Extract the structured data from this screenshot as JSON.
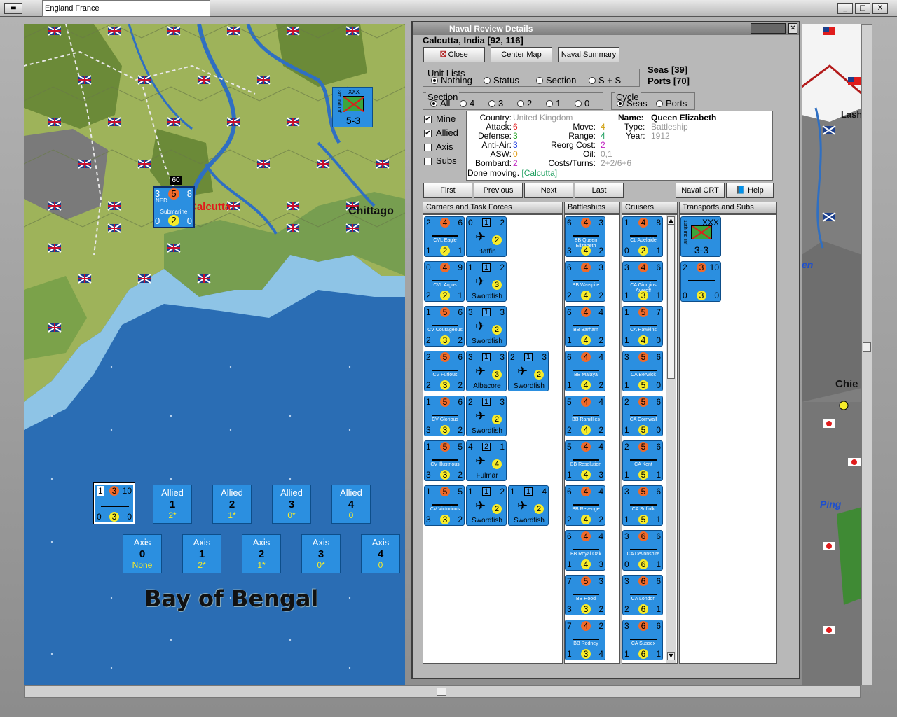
{
  "window": {
    "title": "England France",
    "buttons": [
      "_",
      "□",
      "X"
    ]
  },
  "map": {
    "labels": {
      "bay": "Bay of Bengal",
      "city": "Calcutta",
      "chittagong": "Chittago",
      "lashio": "Lashio",
      "chie": "Chie",
      "ping": "Ping",
      "en": "en"
    },
    "hex_unit": {
      "top_left": "3",
      "attack": "5",
      "top_right": "8",
      "nation": "NED",
      "name": "Submarine",
      "bottom_left": "0",
      "defense": "2",
      "bottom_right": "0",
      "badge": "60"
    },
    "corps": {
      "type": "XXX",
      "name": "3rd Ind Inf",
      "strength": "5-3"
    },
    "stack_unit": {
      "top_left": "1",
      "attack": "3",
      "top_right": "10",
      "bottom_left": "0",
      "defense": "3",
      "bottom_right": "0"
    },
    "allied_boxes": [
      {
        "side": "Allied",
        "num": "1",
        "val": "2*"
      },
      {
        "side": "Allied",
        "num": "2",
        "val": "1*"
      },
      {
        "side": "Allied",
        "num": "3",
        "val": "0*"
      },
      {
        "side": "Allied",
        "num": "4",
        "val": "0"
      }
    ],
    "axis_boxes": [
      {
        "side": "Axis",
        "num": "0",
        "val": "None"
      },
      {
        "side": "Axis",
        "num": "1",
        "val": "2*"
      },
      {
        "side": "Axis",
        "num": "2",
        "val": "1*"
      },
      {
        "side": "Axis",
        "num": "3",
        "val": "0*"
      },
      {
        "side": "Axis",
        "num": "4",
        "val": "0"
      }
    ]
  },
  "panel": {
    "title": "Naval Review Details",
    "location": "Calcutta, India [92, 116]",
    "buttons": {
      "close": "Close",
      "center_map": "Center Map",
      "naval_summary": "Naval Summary",
      "first": "First",
      "previous": "Previous",
      "next": "Next",
      "last": "Last",
      "naval_crt": "Naval CRT",
      "help": "Help"
    },
    "seas": "Seas [39]",
    "ports": "Ports [70]",
    "unit_lists": {
      "title": "Unit Lists",
      "options": [
        "Nothing",
        "Status",
        "Section",
        "S + S"
      ],
      "selected": "Nothing"
    },
    "section": {
      "title": "Section",
      "options": [
        "All",
        "4",
        "3",
        "2",
        "1",
        "0"
      ],
      "selected": "All"
    },
    "cycle": {
      "title": "Cycle",
      "options": [
        "Seas",
        "Ports"
      ],
      "selected": "Seas"
    },
    "filters": [
      {
        "label": "Mine",
        "checked": true
      },
      {
        "label": "Allied",
        "checked": true
      },
      {
        "label": "Axis",
        "checked": false
      },
      {
        "label": "Subs",
        "checked": false
      }
    ],
    "info": {
      "country_k": "Country:",
      "country_v": "United Kingdom",
      "attack_k": "Attack:",
      "attack_v": "6",
      "defense_k": "Defense:",
      "defense_v": "3",
      "antiair_k": "Anti-Air:",
      "antiair_v": "3",
      "asw_k": "ASW:",
      "asw_v": "0",
      "bombard_k": "Bombard:",
      "bombard_v": "2",
      "move_k": "Move:",
      "move_v": "4",
      "range_k": "Range:",
      "range_v": "4",
      "reorg_k": "Reorg Cost:",
      "reorg_v": "2",
      "oil_k": "Oil:",
      "oil_v": "0,1",
      "costs_k": "Costs/Turns:",
      "costs_v": "2+2/6+6",
      "name_k": "Name:",
      "name_v": "Queen Elizabeth",
      "type_k": "Type:",
      "type_v": "Battleship",
      "year_k": "Year:",
      "year_v": "1912",
      "done_k": "Done moving.",
      "done_v": "[Calcutta]"
    },
    "columns": {
      "carriers": "Carriers and Task Forces",
      "battleships": "Battleships",
      "cruisers": "Cruisers",
      "transports": "Transports and Subs"
    },
    "carriers": [
      {
        "tl": "2",
        "a": "4",
        "tr": "6",
        "name": "CVL Eagle",
        "bl": "1",
        "d": "2",
        "br": "1"
      },
      {
        "tl": "0",
        "a": "4",
        "tr": "9",
        "name": "CVL Argus",
        "bl": "2",
        "d": "2",
        "br": "1"
      },
      {
        "tl": "1",
        "a": "5",
        "tr": "6",
        "name": "CV Courageous",
        "bl": "2",
        "d": "3",
        "br": "2"
      },
      {
        "tl": "2",
        "a": "5",
        "tr": "6",
        "name": "CV Furious",
        "bl": "2",
        "d": "3",
        "br": "2"
      },
      {
        "tl": "1",
        "a": "5",
        "tr": "6",
        "name": "CV Glorious",
        "bl": "3",
        "d": "3",
        "br": "2"
      },
      {
        "tl": "1",
        "a": "5",
        "tr": "5",
        "name": "CV Illustrious",
        "bl": "3",
        "d": "3",
        "br": "2"
      },
      {
        "tl": "1",
        "a": "5",
        "tr": "5",
        "name": "CV Victorious",
        "bl": "3",
        "d": "3",
        "br": "2"
      }
    ],
    "aircraft": [
      [
        {
          "tl": "0",
          "sq": "1",
          "tr": "2",
          "c": "2",
          "name": "Baffin"
        }
      ],
      [
        {
          "tl": "1",
          "sq": "1",
          "tr": "2",
          "c": "3",
          "name": "Swordfish"
        }
      ],
      [
        {
          "tl": "3",
          "sq": "1",
          "tr": "3",
          "c": "2",
          "name": "Swordfish"
        }
      ],
      [
        {
          "tl": "3",
          "sq": "1",
          "tr": "3",
          "c": "3",
          "name": "Albacore"
        },
        {
          "tl": "2",
          "sq": "1",
          "tr": "3",
          "c": "2",
          "name": "Swordfish"
        }
      ],
      [
        {
          "tl": "2",
          "sq": "1",
          "tr": "3",
          "c": "2",
          "name": "Swordfish"
        }
      ],
      [
        {
          "tl": "4",
          "sq": "2",
          "tr": "1",
          "c": "4",
          "name": "Fulmar"
        }
      ],
      [
        {
          "tl": "1",
          "sq": "1",
          "tr": "2",
          "c": "2",
          "name": "Swordfish"
        },
        {
          "tl": "1",
          "sq": "1",
          "tr": "4",
          "c": "2",
          "name": "Swordfish"
        }
      ]
    ],
    "battleships": [
      {
        "tl": "6",
        "a": "4",
        "tr": "3",
        "name": "BB Queen Elizabeth",
        "bl": "3",
        "d": "4",
        "br": "2"
      },
      {
        "tl": "6",
        "a": "4",
        "tr": "3",
        "name": "BB Warspite",
        "bl": "2",
        "d": "4",
        "br": "2"
      },
      {
        "tl": "6",
        "a": "4",
        "tr": "4",
        "name": "BB Barham",
        "bl": "1",
        "d": "4",
        "br": "2"
      },
      {
        "tl": "6",
        "a": "4",
        "tr": "4",
        "name": "BB Malaya",
        "bl": "1",
        "d": "4",
        "br": "2"
      },
      {
        "tl": "5",
        "a": "4",
        "tr": "4",
        "name": "BB Ramillies",
        "bl": "2",
        "d": "4",
        "br": "2"
      },
      {
        "tl": "5",
        "a": "4",
        "tr": "4",
        "name": "BB Resolution",
        "bl": "1",
        "d": "4",
        "br": "3"
      },
      {
        "tl": "6",
        "a": "4",
        "tr": "4",
        "name": "BB Revenge",
        "bl": "2",
        "d": "4",
        "br": "2"
      },
      {
        "tl": "6",
        "a": "4",
        "tr": "4",
        "name": "BB Royal Oak",
        "bl": "1",
        "d": "4",
        "br": "3"
      },
      {
        "tl": "7",
        "a": "5",
        "tr": "3",
        "name": "BB Hood",
        "bl": "3",
        "d": "3",
        "br": "2"
      },
      {
        "tl": "7",
        "a": "4",
        "tr": "2",
        "name": "BB Rodney",
        "bl": "1",
        "d": "3",
        "br": "4"
      }
    ],
    "cruisers": [
      {
        "tl": "1",
        "a": "4",
        "tr": "8",
        "name": "CL Adelaide",
        "bl": "0",
        "d": "2",
        "br": "1"
      },
      {
        "tl": "3",
        "a": "4",
        "tr": "6",
        "name": "CA Giorgios Averoff",
        "bl": "1",
        "d": "3",
        "br": "1"
      },
      {
        "tl": "1",
        "a": "5",
        "tr": "7",
        "name": "CA Hawkins",
        "bl": "1",
        "d": "4",
        "br": "0"
      },
      {
        "tl": "3",
        "a": "5",
        "tr": "6",
        "name": "CA Berwick",
        "bl": "1",
        "d": "5",
        "br": "0"
      },
      {
        "tl": "2",
        "a": "5",
        "tr": "6",
        "name": "CA Cornwall",
        "bl": "1",
        "d": "5",
        "br": "0"
      },
      {
        "tl": "2",
        "a": "5",
        "tr": "6",
        "name": "CA Kent",
        "bl": "1",
        "d": "5",
        "br": "1"
      },
      {
        "tl": "3",
        "a": "5",
        "tr": "6",
        "name": "CA Suffolk",
        "bl": "1",
        "d": "5",
        "br": "1"
      },
      {
        "tl": "3",
        "a": "6",
        "tr": "6",
        "name": "CA Devonshire",
        "bl": "0",
        "d": "6",
        "br": "1"
      },
      {
        "tl": "3",
        "a": "6",
        "tr": "6",
        "name": "CA London",
        "bl": "2",
        "d": "6",
        "br": "1"
      },
      {
        "tl": "3",
        "a": "6",
        "tr": "6",
        "name": "CA Sussex",
        "bl": "1",
        "d": "6",
        "br": "1"
      }
    ],
    "transports": [
      {
        "kind": "corps",
        "type": "XXX",
        "name": "16th Ind Inf",
        "strength": "3-3"
      },
      {
        "kind": "ship",
        "tl": "2",
        "a": "3",
        "tr": "10",
        "bl": "0",
        "d": "3",
        "br": "0"
      }
    ]
  },
  "colors": {
    "sea": "#2a6db4",
    "unit": "#2b8fe0",
    "attack": "#f06a2a",
    "defense": "#f7ec2a"
  }
}
